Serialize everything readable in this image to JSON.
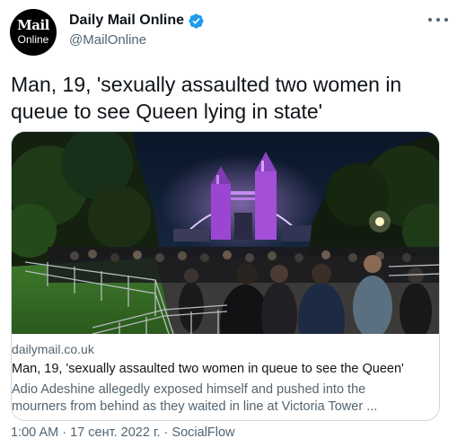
{
  "account": {
    "avatar_line1": "Mail",
    "avatar_line2": "Online",
    "display_name": "Daily Mail Online",
    "handle": "@MailOnline",
    "verified": true
  },
  "tweet": {
    "text": "Man, 19, 'sexually assaulted two women in queue to see Queen lying in state'"
  },
  "card": {
    "domain": "dailymail.co.uk",
    "title": "Man, 19, 'sexually assaulted two women in queue to see the Queen'",
    "description": "Adio Adeshine allegedly exposed himself and pushed into the mourners from behind as they waited in line at Victoria Tower ..."
  },
  "meta": {
    "time": "1:00 AM",
    "separator": "·",
    "date": "17 сент. 2022 г.",
    "source": "SocialFlow"
  },
  "colors": {
    "verified_badge": "#1d9bf0",
    "text_primary": "#0f1419",
    "text_secondary": "#536471",
    "border": "#cfd9de",
    "bridge_light": "#a44fd8"
  },
  "icons": {
    "verified": "verified-badge-icon",
    "more": "more-options-icon"
  }
}
